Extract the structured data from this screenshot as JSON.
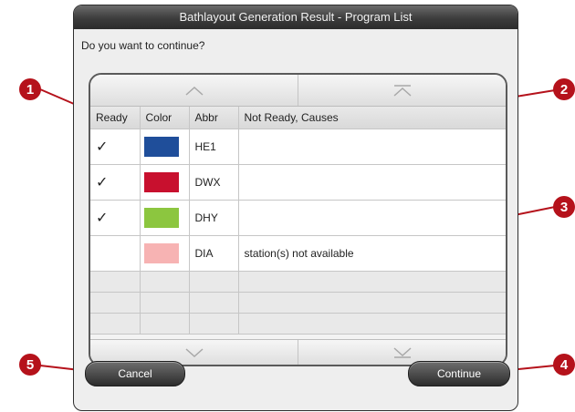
{
  "dialog": {
    "title": "Bathlayout Generation Result - Program List",
    "question": "Do you want to continue?"
  },
  "table": {
    "columns": [
      "Ready",
      "Color",
      "Abbr",
      "Not Ready, Causes"
    ],
    "rows": [
      {
        "ready": "✓",
        "color": "#1f4e9a",
        "abbr": "HE1",
        "cause": ""
      },
      {
        "ready": "✓",
        "color": "#c8102e",
        "abbr": "DWX",
        "cause": ""
      },
      {
        "ready": "✓",
        "color": "#8cc63f",
        "abbr": "DHY",
        "cause": ""
      },
      {
        "ready": "",
        "color": "#f7b3b3",
        "abbr": "DIA",
        "cause": "station(s) not available"
      }
    ],
    "empty_row_count": 3
  },
  "scroll": {
    "up_icon": "chevron-up-icon",
    "top_icon": "chevron-to-top-icon",
    "down_icon": "chevron-down-icon",
    "bottom_icon": "chevron-to-bottom-icon"
  },
  "buttons": {
    "cancel": "Cancel",
    "continue": "Continue"
  },
  "callouts": [
    "1",
    "2",
    "3",
    "4",
    "5"
  ],
  "colors": {
    "callout": "#b5121b",
    "titlebar": "#3c3c3c",
    "button": "#2c2c2c"
  }
}
